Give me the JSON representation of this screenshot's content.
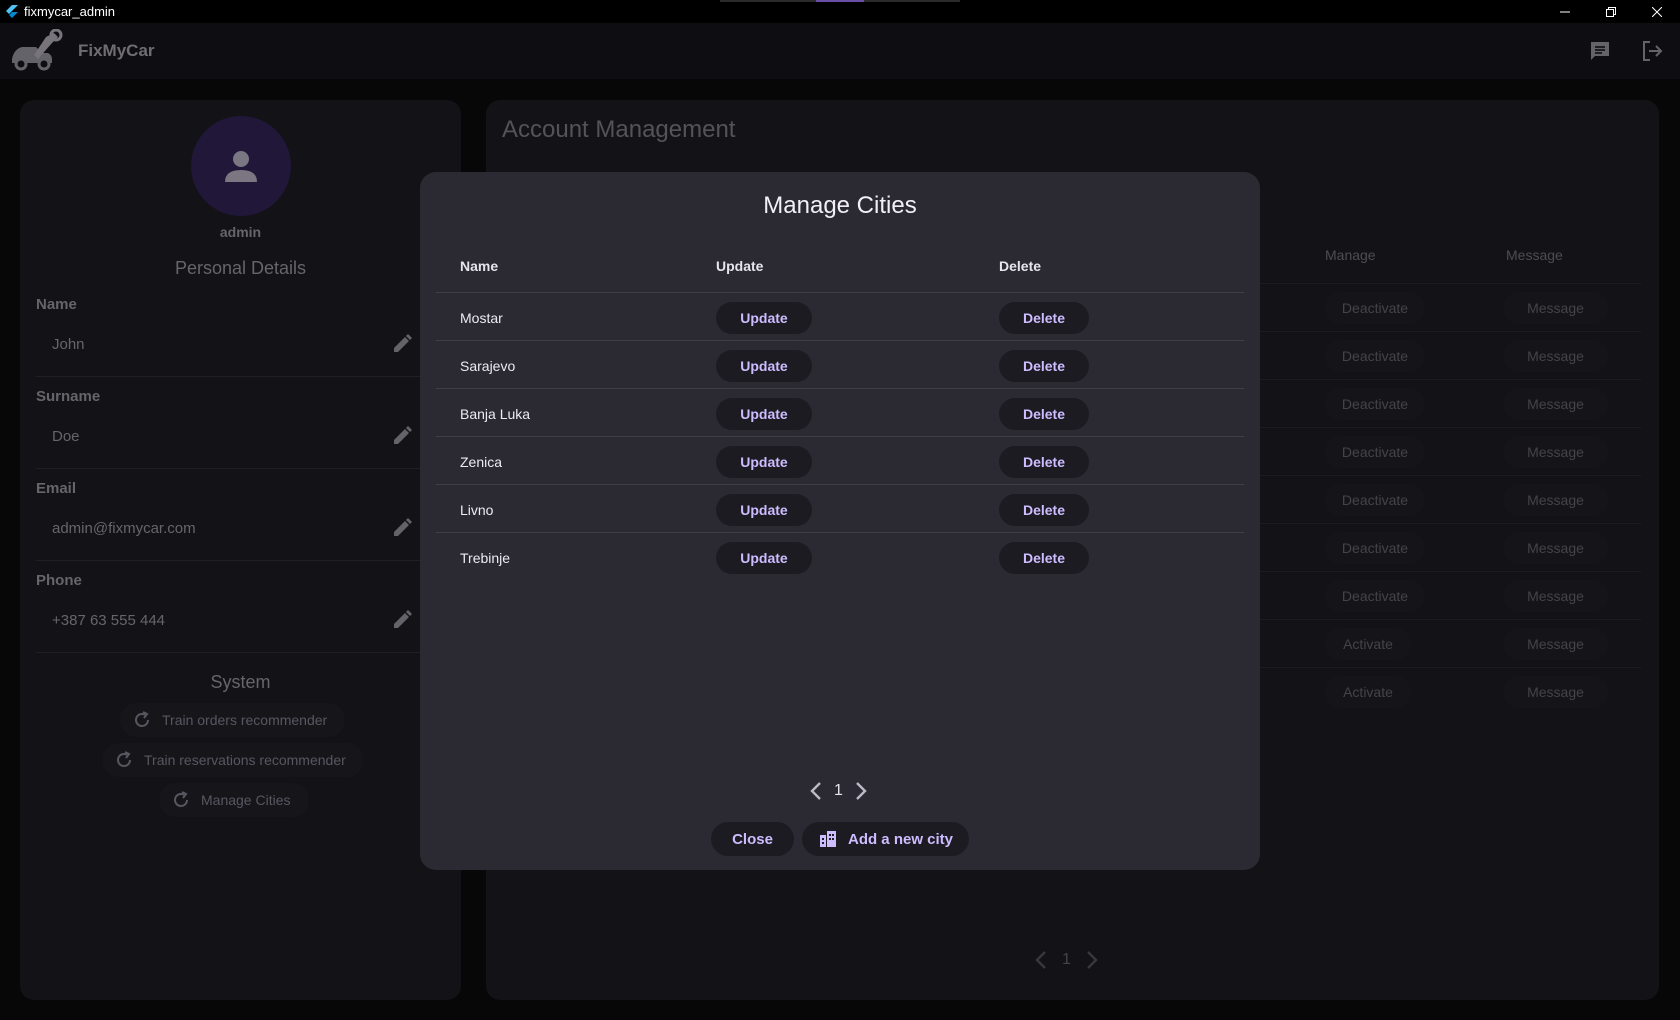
{
  "window": {
    "title": "fixmycar_admin"
  },
  "appbar": {
    "brand": "FixMyCar",
    "logo_icon": "car-wrench-logo",
    "chat_icon": "chat-icon",
    "logout_icon": "logout-icon"
  },
  "profile": {
    "username": "admin",
    "personal_details_title": "Personal Details",
    "fields": [
      {
        "label": "Name",
        "value": "John"
      },
      {
        "label": "Surname",
        "value": "Doe"
      },
      {
        "label": "Email",
        "value": "admin@fixmycar.com"
      },
      {
        "label": "Phone",
        "value": "+387 63 555 444"
      }
    ],
    "system_title": "System",
    "system_buttons": [
      {
        "label": "Train orders recommender"
      },
      {
        "label": "Train reservations recommender"
      },
      {
        "label": "Manage Cities"
      }
    ]
  },
  "account_management": {
    "heading": "Account Management",
    "columns": {
      "manage": "Manage",
      "message": "Message"
    },
    "rows": [
      {
        "manage": "Deactivate",
        "message": "Message"
      },
      {
        "manage": "Deactivate",
        "message": "Message"
      },
      {
        "manage": "Deactivate",
        "message": "Message"
      },
      {
        "manage": "Deactivate",
        "message": "Message"
      },
      {
        "manage": "Deactivate",
        "message": "Message"
      },
      {
        "manage": "Deactivate",
        "message": "Message"
      },
      {
        "manage": "Deactivate",
        "message": "Message"
      },
      {
        "manage": "Activate",
        "message": "Message"
      },
      {
        "manage": "Activate",
        "message": "Message"
      }
    ],
    "page": "1"
  },
  "modal": {
    "title": "Manage Cities",
    "columns": {
      "name": "Name",
      "update": "Update",
      "delete": "Delete"
    },
    "rows": [
      {
        "name": "Mostar",
        "update": "Update",
        "delete": "Delete"
      },
      {
        "name": "Sarajevo",
        "update": "Update",
        "delete": "Delete"
      },
      {
        "name": "Banja Luka",
        "update": "Update",
        "delete": "Delete"
      },
      {
        "name": "Zenica",
        "update": "Update",
        "delete": "Delete"
      },
      {
        "name": "Livno",
        "update": "Update",
        "delete": "Delete"
      },
      {
        "name": "Trebinje",
        "update": "Update",
        "delete": "Delete"
      }
    ],
    "page": "1",
    "close_label": "Close",
    "add_label": "Add a new city"
  },
  "colors": {
    "accent": "#cdbcff",
    "avatar_bg": "#2d2150",
    "modal_bg": "#2b2932",
    "panel_bg": "#1a1920"
  }
}
